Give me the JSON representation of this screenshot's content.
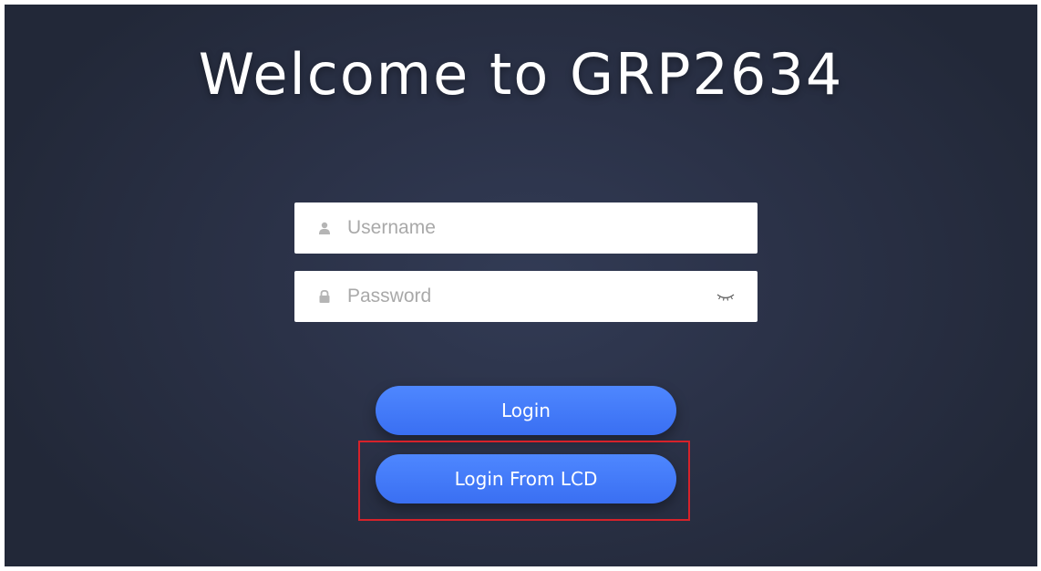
{
  "page": {
    "title": "Welcome to GRP2634"
  },
  "login_form": {
    "username_placeholder": "Username",
    "password_placeholder": "Password",
    "login_label": "Login",
    "login_lcd_label": "Login From LCD"
  },
  "icons": {
    "username": "user-icon",
    "password": "lock-icon",
    "password_toggle": "eye-closed-icon"
  },
  "colors": {
    "background": "#2b3248",
    "button": "#3f77f7",
    "highlight_box": "#d6222a"
  }
}
